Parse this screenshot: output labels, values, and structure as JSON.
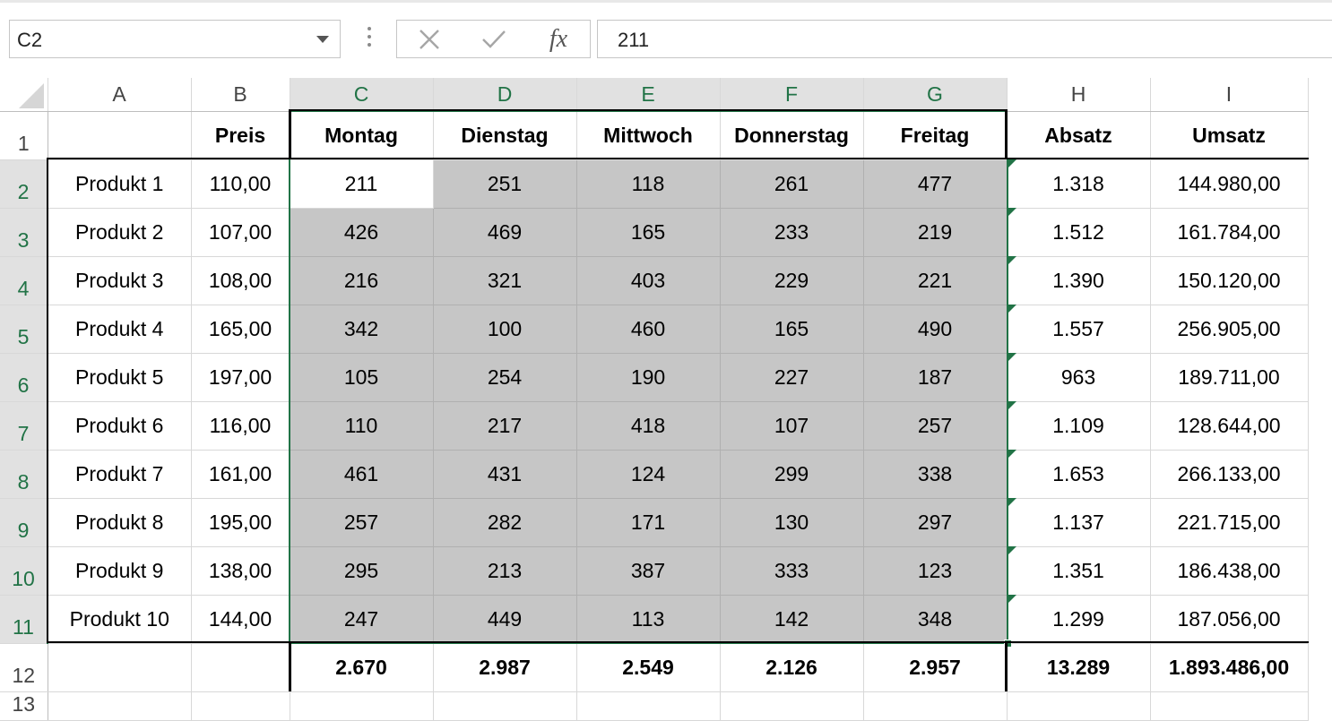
{
  "formula_bar": {
    "name_box": "C2",
    "formula": "211",
    "function_icon": "fx"
  },
  "columns": [
    "A",
    "B",
    "C",
    "D",
    "E",
    "F",
    "G",
    "H",
    "I"
  ],
  "rows": [
    {
      "num": "1",
      "cells": [
        "",
        "Preis",
        "Montag",
        "Dienstag",
        "Mittwoch",
        "Donnerstag",
        "Freitag",
        "Absatz",
        "Umsatz"
      ]
    },
    {
      "num": "2",
      "cells": [
        "Produkt 1",
        "110,00",
        "211",
        "251",
        "118",
        "261",
        "477",
        "1.318",
        "144.980,00"
      ]
    },
    {
      "num": "3",
      "cells": [
        "Produkt 2",
        "107,00",
        "426",
        "469",
        "165",
        "233",
        "219",
        "1.512",
        "161.784,00"
      ]
    },
    {
      "num": "4",
      "cells": [
        "Produkt 3",
        "108,00",
        "216",
        "321",
        "403",
        "229",
        "221",
        "1.390",
        "150.120,00"
      ]
    },
    {
      "num": "5",
      "cells": [
        "Produkt 4",
        "165,00",
        "342",
        "100",
        "460",
        "165",
        "490",
        "1.557",
        "256.905,00"
      ]
    },
    {
      "num": "6",
      "cells": [
        "Produkt 5",
        "197,00",
        "105",
        "254",
        "190",
        "227",
        "187",
        "963",
        "189.711,00"
      ]
    },
    {
      "num": "7",
      "cells": [
        "Produkt 6",
        "116,00",
        "110",
        "217",
        "418",
        "107",
        "257",
        "1.109",
        "128.644,00"
      ]
    },
    {
      "num": "8",
      "cells": [
        "Produkt 7",
        "161,00",
        "461",
        "431",
        "124",
        "299",
        "338",
        "1.653",
        "266.133,00"
      ]
    },
    {
      "num": "9",
      "cells": [
        "Produkt 8",
        "195,00",
        "257",
        "282",
        "171",
        "130",
        "297",
        "1.137",
        "221.715,00"
      ]
    },
    {
      "num": "10",
      "cells": [
        "Produkt 9",
        "138,00",
        "295",
        "213",
        "387",
        "333",
        "123",
        "1.351",
        "186.438,00"
      ]
    },
    {
      "num": "11",
      "cells": [
        "Produkt 10",
        "144,00",
        "247",
        "449",
        "113",
        "142",
        "348",
        "1.299",
        "187.056,00"
      ]
    },
    {
      "num": "12",
      "cells": [
        "",
        "",
        "2.670",
        "2.987",
        "2.549",
        "2.126",
        "2.957",
        "13.289",
        "1.893.486,00"
      ]
    },
    {
      "num": "13",
      "cells": [
        "",
        "",
        "",
        "",
        "",
        "",
        "",
        "",
        ""
      ]
    }
  ],
  "colors": {
    "accent": "#217346",
    "selection_fill": "#c6c6c6",
    "header_selected_fill": "#e1e1e1"
  },
  "selection": {
    "active_cell": "C2",
    "range": "C2:G11"
  }
}
